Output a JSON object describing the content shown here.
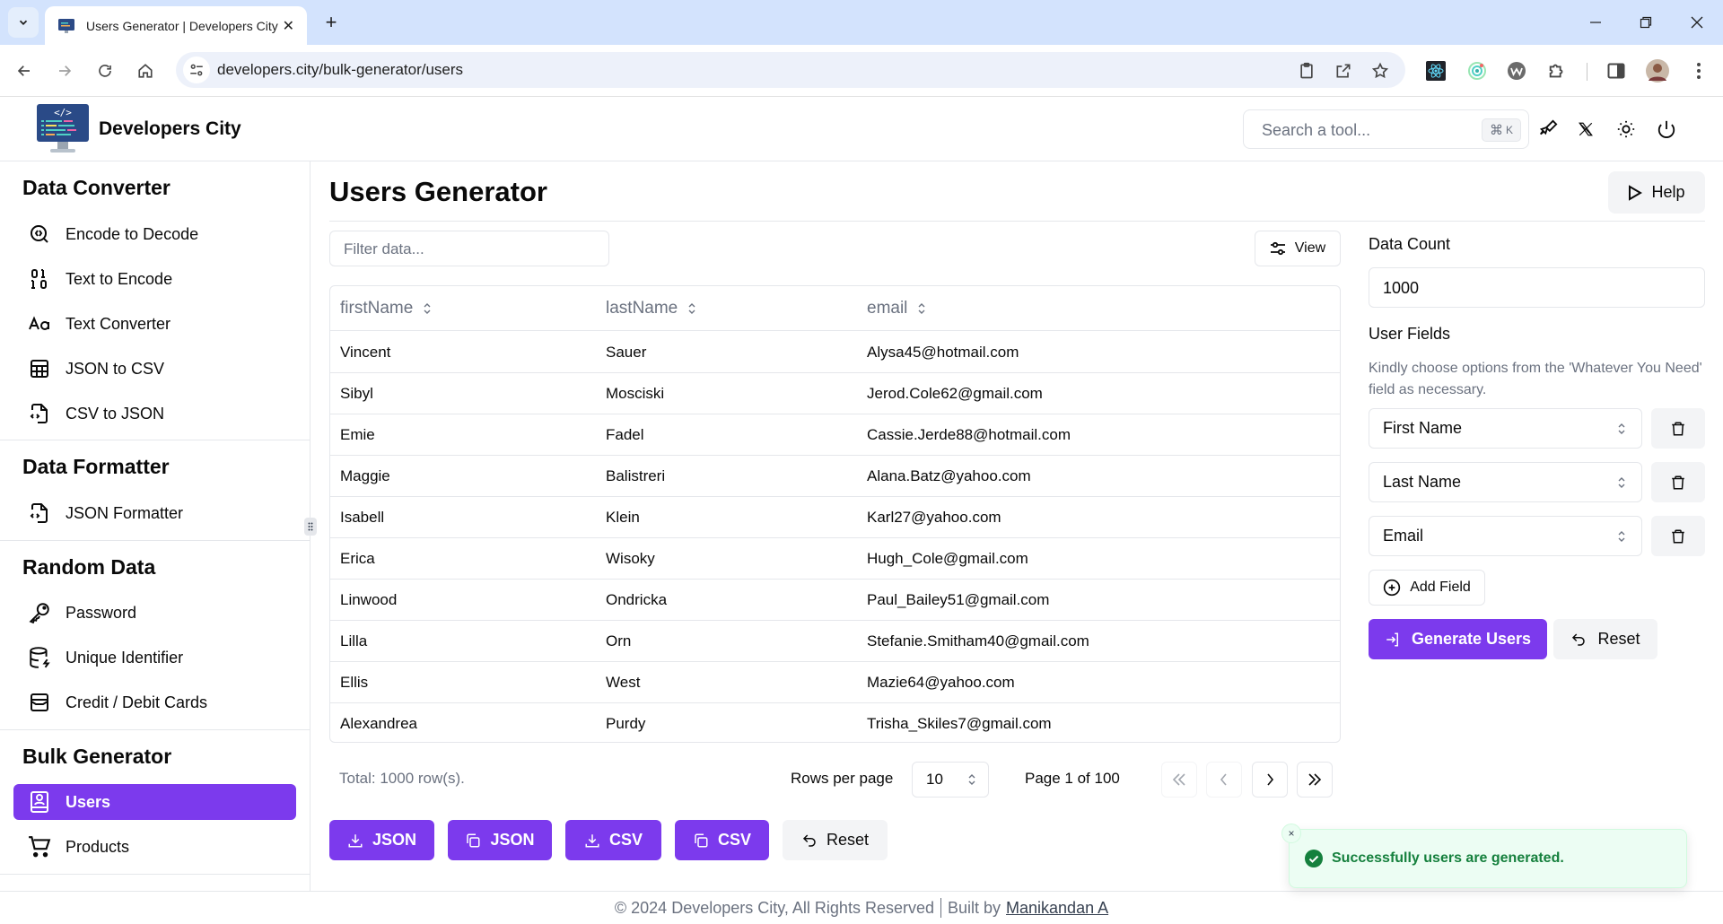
{
  "browser": {
    "tab_title": "Users Generator | Developers City",
    "url": "developers.city/bulk-generator/users"
  },
  "header": {
    "brand": "Developers City",
    "search_placeholder": "Search a tool...",
    "search_shortcut_key": "K",
    "search_shortcut_mod": "⌘"
  },
  "sidebar": {
    "sections": [
      {
        "title": "Data Converter",
        "items": [
          {
            "label": "Encode to Decode",
            "icon": "search-code-icon"
          },
          {
            "label": "Text to Encode",
            "icon": "binary-icon"
          },
          {
            "label": "Text Converter",
            "icon": "case-sensitive-icon"
          },
          {
            "label": "JSON to CSV",
            "icon": "table-icon"
          },
          {
            "label": "CSV to JSON",
            "icon": "file-json-icon"
          }
        ]
      },
      {
        "title": "Data Formatter",
        "items": [
          {
            "label": "JSON Formatter",
            "icon": "file-json-icon"
          }
        ]
      },
      {
        "title": "Random Data",
        "items": [
          {
            "label": "Password",
            "icon": "key-icon"
          },
          {
            "label": "Unique Identifier",
            "icon": "database-zap-icon"
          },
          {
            "label": "Credit / Debit Cards",
            "icon": "wallet-card-icon"
          }
        ]
      },
      {
        "title": "Bulk Generator",
        "items": [
          {
            "label": "Users",
            "icon": "contact-book-icon",
            "active": true
          },
          {
            "label": "Products",
            "icon": "shopping-cart-icon"
          }
        ]
      }
    ]
  },
  "main": {
    "title": "Users Generator",
    "help_label": "Help",
    "filter_placeholder": "Filter data...",
    "view_label": "View",
    "table": {
      "columns": [
        "firstName",
        "lastName",
        "email"
      ],
      "rows": [
        [
          "Vincent",
          "Sauer",
          "Alysa45@hotmail.com"
        ],
        [
          "Sibyl",
          "Mosciski",
          "Jerod.Cole62@gmail.com"
        ],
        [
          "Emie",
          "Fadel",
          "Cassie.Jerde88@hotmail.com"
        ],
        [
          "Maggie",
          "Balistreri",
          "Alana.Batz@yahoo.com"
        ],
        [
          "Isabell",
          "Klein",
          "Karl27@yahoo.com"
        ],
        [
          "Erica",
          "Wisoky",
          "Hugh_Cole@gmail.com"
        ],
        [
          "Linwood",
          "Ondricka",
          "Paul_Bailey51@gmail.com"
        ],
        [
          "Lilla",
          "Orn",
          "Stefanie.Smitham40@gmail.com"
        ],
        [
          "Ellis",
          "West",
          "Mazie64@yahoo.com"
        ],
        [
          "Alexandrea",
          "Purdy",
          "Trisha_Skiles7@gmail.com"
        ]
      ]
    },
    "pagination": {
      "total": "Total: 1000 row(s).",
      "rows_per_page_label": "Rows per page",
      "rows_per_page_value": "10",
      "page_info": "Page 1 of 100"
    },
    "actions": [
      {
        "label": "JSON",
        "icon": "download-icon",
        "name": "download-json-button"
      },
      {
        "label": "JSON",
        "icon": "copy-icon",
        "name": "copy-json-button"
      },
      {
        "label": "CSV",
        "icon": "download-icon",
        "name": "download-csv-button"
      },
      {
        "label": "CSV",
        "icon": "copy-icon",
        "name": "copy-csv-button"
      },
      {
        "label": "Reset",
        "icon": "undo-icon",
        "name": "reset-table-button"
      }
    ]
  },
  "panel": {
    "data_count_label": "Data Count",
    "data_count_value": "1000",
    "user_fields_label": "User Fields",
    "user_fields_help": "Kindly choose options from the 'Whatever You Need' field as necessary.",
    "fields": [
      "First Name",
      "Last Name",
      "Email"
    ],
    "add_field_label": "Add Field",
    "generate_label": "Generate Users",
    "reset_label": "Reset"
  },
  "footer": {
    "copyright": "© 2024 Developers City, All Rights Reserved",
    "built_by": "Built by",
    "author": "Manikandan A"
  },
  "toast": {
    "message": "Successfully users are generated.",
    "close": "×"
  },
  "colors": {
    "accent": "#7c3aed",
    "success": "#15803d",
    "toast_bg": "#ecfdf3"
  }
}
